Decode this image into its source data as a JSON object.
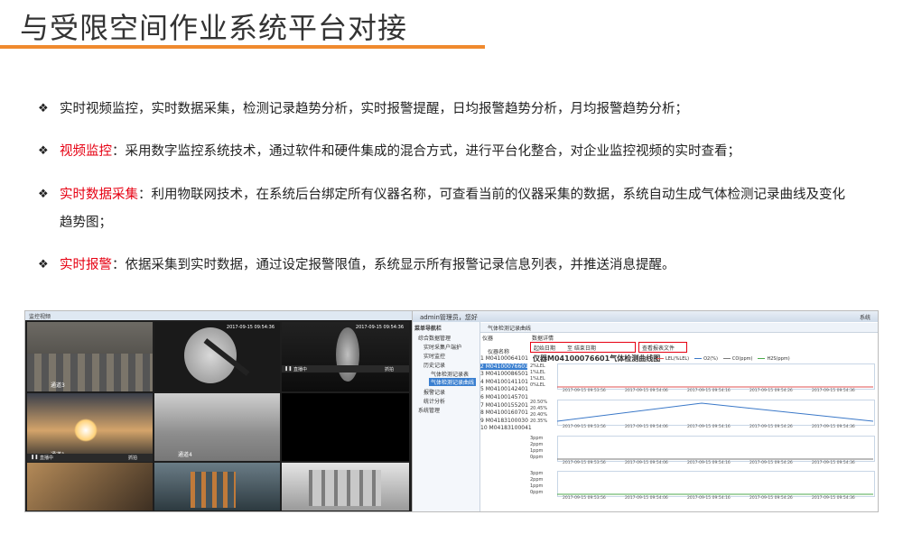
{
  "title": "与受限空间作业系统平台对接",
  "bullets": [
    {
      "lead": "",
      "text": "实时视频监控，实时数据采集，检测记录趋势分析，实时报警提醒，日均报警趋势分析，月均报警趋势分析；"
    },
    {
      "lead": "视频监控",
      "text": "：采用数字监控系统技术，通过软件和硬件集成的混合方式，进行平台化整合，对企业监控视频的实时查看；"
    },
    {
      "lead": "实时数据采集",
      "text": "：利用物联网技术，在系统后台绑定所有仪器名称，可查看当前的仪器采集的数据，系统自动生成气体检测记录曲线及变化",
      "text2": "趋势图；"
    },
    {
      "lead": "实时报警",
      "text": "：依据采集到实时数据，通过设定报警限值，系统显示所有报警记录信息列表，并推送消息提醒。"
    }
  ],
  "bullet_symbol": "❖",
  "colors": {
    "accent_line": "#f08a2e",
    "highlight": "#e60012"
  },
  "video": {
    "tab": "监控视频",
    "cameras": [
      {
        "label": "通道3",
        "time": ""
      },
      {
        "label": "",
        "time": "2017-09-15 09:54:36"
      },
      {
        "label": "",
        "time": "2017-09-15 09:54:36"
      },
      {
        "label": "通道1",
        "time": ""
      },
      {
        "label": "通道4",
        "time": ""
      },
      {
        "label": "",
        "time": ""
      },
      {
        "label": "",
        "time": ""
      },
      {
        "label": "",
        "time": ""
      },
      {
        "label": "",
        "time": ""
      }
    ],
    "ctrl1": "直播中",
    "ctrl2": "直播中",
    "ctrl_btn": "抓拍"
  },
  "software": {
    "user": "admin管理员，您好",
    "logout": "系统",
    "tree_title": "菜单导航栏",
    "tree": [
      "综合数据管理",
      "实时采集户端护",
      "实时监控",
      "历史记录",
      "气体检测记录表",
      "气体检测记录曲线",
      "报警记录",
      "统计分析",
      "系统管理"
    ],
    "tab": "气体检测记录曲线",
    "col_device": "仪器",
    "col_name": "仪器名称",
    "devices": [
      {
        "no": "1",
        "id": "M04100064101"
      },
      {
        "no": "2",
        "id": "M04100076601"
      },
      {
        "no": "3",
        "id": "M04100086501"
      },
      {
        "no": "4",
        "id": "M04100141101"
      },
      {
        "no": "5",
        "id": "M04100142401"
      },
      {
        "no": "6",
        "id": "M04100145701"
      },
      {
        "no": "7",
        "id": "M04100155201"
      },
      {
        "no": "8",
        "id": "M04100160701"
      },
      {
        "no": "9",
        "id": "M04183100030"
      },
      {
        "no": "10",
        "id": "M04183100041"
      }
    ],
    "data_detail": "数据详情",
    "start_label": "起始日期",
    "end_label": "至  结束日期",
    "query_btn": "查看报表文件",
    "chart_title": "仪器M04100076601气体检测曲线图",
    "legend": [
      "LEL(%LEL)",
      "O2(%)",
      "CO(ppm)",
      "H2S(ppm)"
    ],
    "legend_colors": [
      "#e05050",
      "#3a78c8",
      "#7a7a7a",
      "#4caa4c"
    ],
    "panels": [
      {
        "yticks": [
          "2%LEL",
          "1%LEL",
          "1%LEL",
          "0%LEL"
        ]
      },
      {
        "yticks": [
          "20.50%",
          "20.45%",
          "20.40%",
          "20.35%"
        ]
      },
      {
        "yticks": [
          "3ppm",
          "2ppm",
          "1ppm",
          "0ppm"
        ]
      },
      {
        "yticks": [
          "3ppm",
          "2ppm",
          "1ppm",
          "0ppm"
        ]
      }
    ],
    "xticks": [
      "2017-09-15 09:53:56",
      "2017-09-15 09:54:06",
      "2017-09-15 09:54:16",
      "2017-09-15 09:54:26",
      "2017-09-15 09:54:36"
    ]
  }
}
